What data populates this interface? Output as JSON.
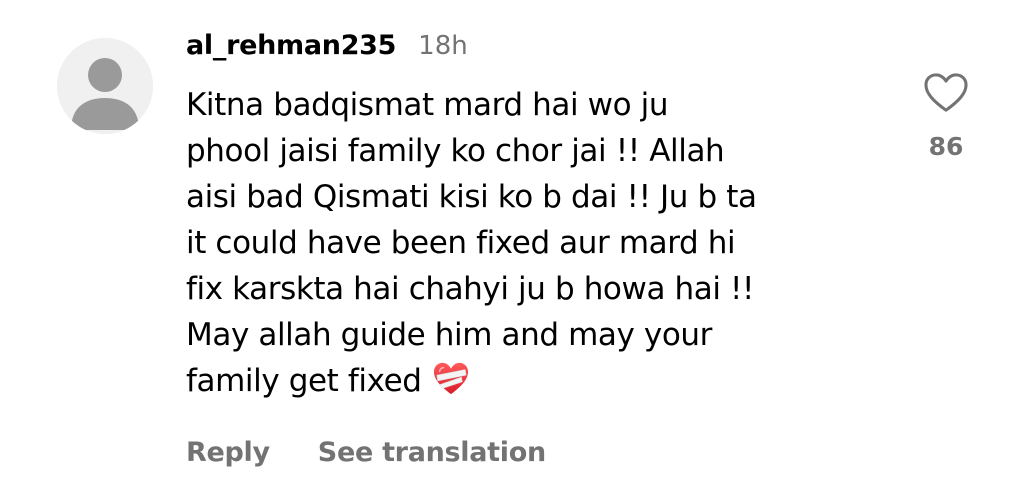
{
  "comment": {
    "username": "al_rehman235",
    "timestamp": "18h",
    "lines": [
      "Kitna badqismat mard hai wo ju",
      "phool jaisi family ko chor jai !! Allah",
      "aisi bad Qismati kisi ko b dai !! Ju b ta",
      "it could have been fixed aur mard hi",
      "fix karskta hai chahyi ju b howa hai !!",
      "May allah guide him and may your",
      "family get fixed"
    ],
    "emoji": "mending-heart-icon",
    "actions": {
      "reply": "Reply",
      "see_translation": "See translation"
    },
    "likes": {
      "icon": "heart-outline-icon",
      "count": "86"
    }
  },
  "colors": {
    "text": "#000000",
    "secondary": "#737373",
    "avatar_bg": "#f0f0f0",
    "avatar_fg": "#dbdbdb"
  }
}
